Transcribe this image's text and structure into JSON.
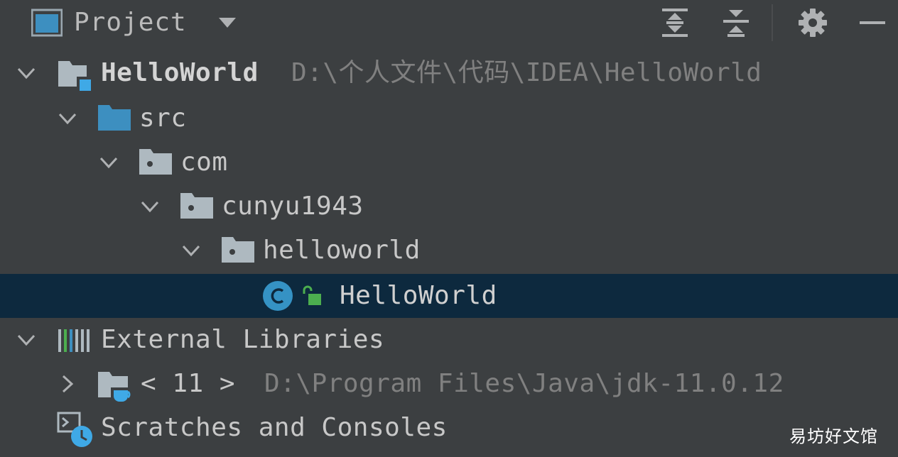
{
  "header": {
    "title": "Project",
    "toolbar": [
      "expand-all-icon",
      "collapse-all-icon",
      "gear-icon",
      "hide-icon"
    ]
  },
  "tree": {
    "root_label": "HelloWorld",
    "root_path": "D:\\个人文件\\代码\\IDEA\\HelloWorld",
    "src_label": "src",
    "com_label": "com",
    "cunyu_label": "cunyu1943",
    "helloworld_pkg_label": "helloworld",
    "class_label": "HelloWorld",
    "ext_libs_label": "External Libraries",
    "jdk_label": "< 11 >",
    "jdk_path": "D:\\Program Files\\Java\\jdk-11.0.12",
    "scratches_label": "Scratches and Consoles"
  },
  "colors": {
    "background": "#3c3f41",
    "selection": "#0d293e",
    "folder_blue": "#3d8fc0",
    "folder_gray": "#aeb9c0",
    "unlock_green": "#4cae4f"
  },
  "watermark": "易坊好文馆"
}
